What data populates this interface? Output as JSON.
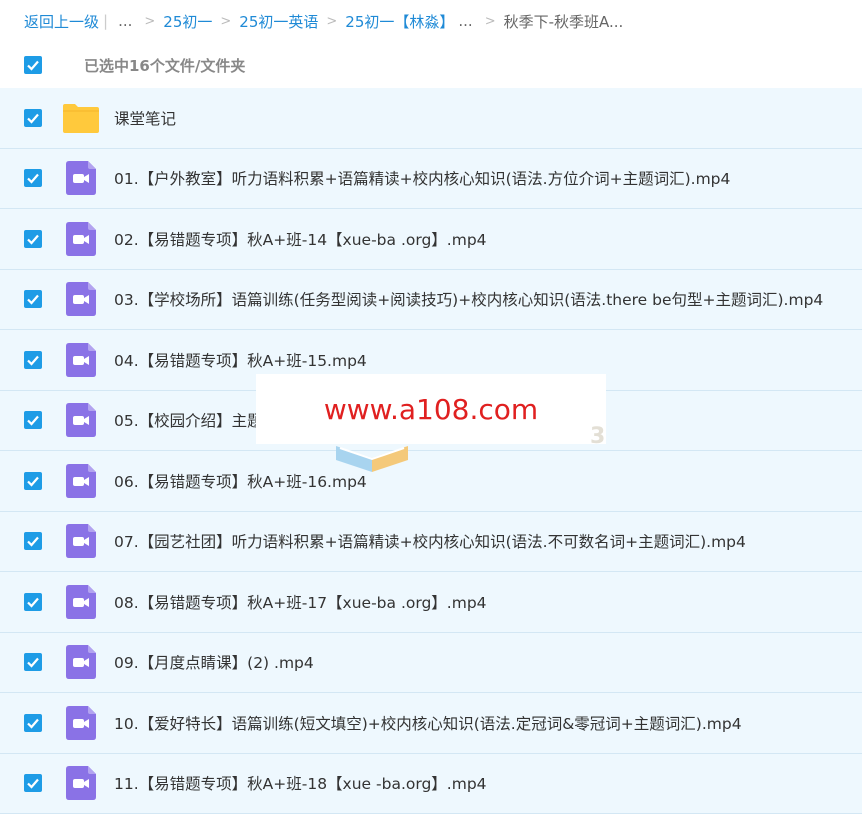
{
  "breadcrumb": {
    "back": "返回上一级",
    "ellipsis": "...",
    "items": [
      "25初一",
      "25初一英语",
      "25初一【林淼】"
    ],
    "current": "秋季下-秋季班A..."
  },
  "selection": {
    "text": "已选中16个文件/文件夹",
    "checked": true
  },
  "files": [
    {
      "name": "课堂笔记",
      "type": "folder"
    },
    {
      "name": "01.【户外教室】听力语料积累+语篇精读+校内核心知识(语法.方位介词+主题词汇).mp4",
      "type": "video"
    },
    {
      "name": "02.【易错题专项】秋A+班-14【xue-ba .org】.mp4",
      "type": "video"
    },
    {
      "name": "03.【学校场所】语篇训练(任务型阅读+阅读技巧)+校内核心知识(语法.there be句型+主题词汇).mp4",
      "type": "video"
    },
    {
      "name": "04.【易错题专项】秋A+班-15.mp4",
      "type": "video"
    },
    {
      "name": "05.【校园介绍】主题",
      "type": "video"
    },
    {
      "name": "06.【易错题专项】秋A+班-16.mp4",
      "type": "video"
    },
    {
      "name": "07.【园艺社团】听力语料积累+语篇精读+校内核心知识(语法.不可数名词+主题词汇).mp4",
      "type": "video"
    },
    {
      "name": "08.【易错题专项】秋A+班-17【xue-ba .org】.mp4",
      "type": "video"
    },
    {
      "name": "09.【月度点睛课】(2) .mp4",
      "type": "video"
    },
    {
      "name": "10.【爱好特长】语篇训练(短文填空)+校内核心知识(语法.定冠词&零冠词+主题词汇).mp4",
      "type": "video"
    },
    {
      "name": "11.【易错题专项】秋A+班-18【xue -ba.org】.mp4",
      "type": "video"
    }
  ],
  "watermark": {
    "text": "www.a108.com",
    "color": "#e02020",
    "mark": "3"
  },
  "colors": {
    "accent": "#1e9ce6",
    "link": "#1f8ad6",
    "row_bg": "#eef8fe",
    "video_icon": "#8a72e6",
    "folder_icon": "#ffc93c"
  }
}
